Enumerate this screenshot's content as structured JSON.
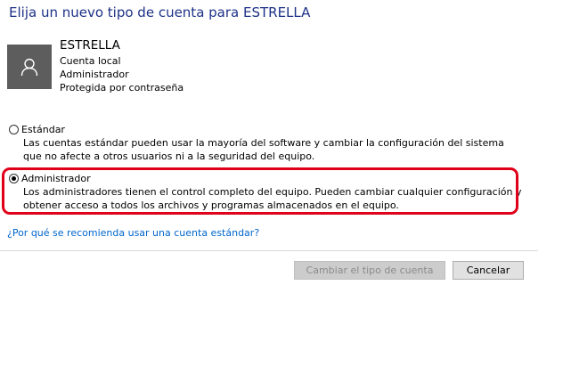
{
  "title": "Elija un nuevo tipo de cuenta para ESTRELLA",
  "user": {
    "name": "ESTRELLA",
    "details": [
      "Cuenta local",
      "Administrador",
      "Protegida por contraseña"
    ]
  },
  "options": [
    {
      "label": "Estándar",
      "description": "Las cuentas estándar pueden usar la mayoría del software y cambiar la configuración del sistema que no afecte a otros usuarios ni a la seguridad del equipo.",
      "selected": false
    },
    {
      "label": "Administrador",
      "description": "Los administradores tienen el control completo del equipo. Pueden cambiar cualquier configuración y obtener acceso a todos los archivos y programas almacenados en el equipo.",
      "selected": true
    }
  ],
  "link_text": "¿Por qué se recomienda usar una cuenta estándar?",
  "buttons": {
    "change": "Cambiar el tipo de cuenta",
    "cancel": "Cancelar"
  },
  "colors": {
    "title": "#1e3287",
    "link": "#0066cc",
    "highlight": "#e0001a",
    "avatar_bg": "#5d5d5d"
  }
}
